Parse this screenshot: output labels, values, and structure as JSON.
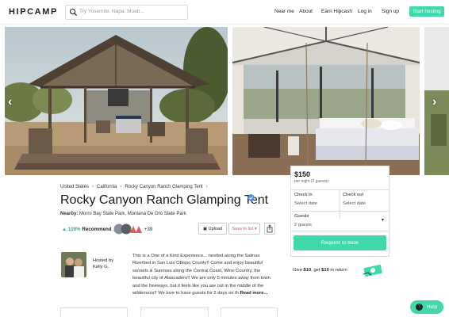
{
  "nav": {
    "logo": "HIPCAMP",
    "search_placeholder": "Try Yosemite, Napa, Moab...",
    "links": [
      "Near me",
      "About",
      "Earn Hipcash",
      "Log in",
      "Sign up"
    ],
    "cta": "Start hosting"
  },
  "breadcrumb": [
    "United States",
    "California",
    "Rocky Canyon Ranch Glamping Tent"
  ],
  "listing": {
    "title": "Rocky Canyon Ranch Glamping Tent",
    "nearby_label": "Nearby:",
    "nearby": "Morro Bay State Park, Montana De Oro State Park",
    "recommend_pct": "100%",
    "recommend_label": "Recommend",
    "more_count": "+39",
    "upload_label": "Upload",
    "save_label": "Save to list",
    "hosted_by_label": "Hosted by",
    "host_name": "Kelly G.",
    "description": "This is a One of a Kind Experience... nestled along the Salinas Riverbed in San Luis Obispo County!! Come and enjoy beautiful sunsets & Sunrises along the Central Coast, Wine Country, the beautiful city of Atascadero!! We are only 5 minutes away from town and the freeways, but it feels like you are out in the middle of the wilderness!! We love to have guests for 2 days on th",
    "read_more": "Read more..."
  },
  "booking": {
    "price": "$150",
    "per_night": "per night (2 guests)",
    "checkin_label": "Check in",
    "checkin_value": "Select date",
    "checkout_label": "Check out",
    "checkout_value": "Select date",
    "guests_label": "Guests",
    "guests_value": "2 guests",
    "request_button": "Request to book"
  },
  "referral": {
    "give_prefix": "Give",
    "give_amount": "$10",
    "middle": ", get",
    "get_amount": "$10",
    "suffix": "in return"
  },
  "help_label": "Help",
  "colors": {
    "accent": "#40d9ac",
    "save": "#e15a5a",
    "recommend": "#33b07a",
    "verified": "#4a90e2"
  }
}
